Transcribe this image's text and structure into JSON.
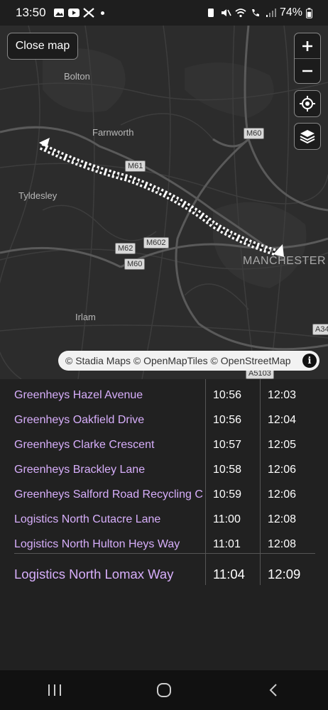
{
  "status_bar": {
    "time": "13:50",
    "battery": "74%"
  },
  "map": {
    "close_label": "Close map",
    "zoom_in": "+",
    "zoom_out": "−",
    "attribution": "© Stadia Maps © OpenMapTiles © OpenStreetMap",
    "info_label": "i",
    "places": [
      "Bolton",
      "Farnworth",
      "Tyldesley",
      "Irlam",
      "MANCHESTER"
    ],
    "shields": [
      "M60",
      "M61",
      "M62",
      "M602",
      "M60",
      "A5103",
      "A34"
    ],
    "route_color": "#ffffff"
  },
  "timetable": {
    "rows": [
      {
        "stop": "Greenheys Hazel Avenue",
        "t1": "10:56",
        "t2": "12:03"
      },
      {
        "stop": "Greenheys Oakfield Drive",
        "t1": "10:56",
        "t2": "12:04"
      },
      {
        "stop": "Greenheys Clarke Crescent",
        "t1": "10:57",
        "t2": "12:05"
      },
      {
        "stop": "Greenheys Brackley Lane",
        "t1": "10:58",
        "t2": "12:06"
      },
      {
        "stop": "Greenheys Salford Road Recycling C",
        "t1": "10:59",
        "t2": "12:06"
      },
      {
        "stop": "Logistics North Cutacre Lane",
        "t1": "11:00",
        "t2": "12:08"
      },
      {
        "stop": "Logistics North Hulton Heys Way",
        "t1": "11:01",
        "t2": "12:08"
      }
    ],
    "last_row": {
      "stop": "Logistics North Lomax Way",
      "t1": "11:04",
      "t2": "12:09"
    }
  },
  "colors": {
    "stop_text": "#d7aefb",
    "background": "#212121"
  }
}
